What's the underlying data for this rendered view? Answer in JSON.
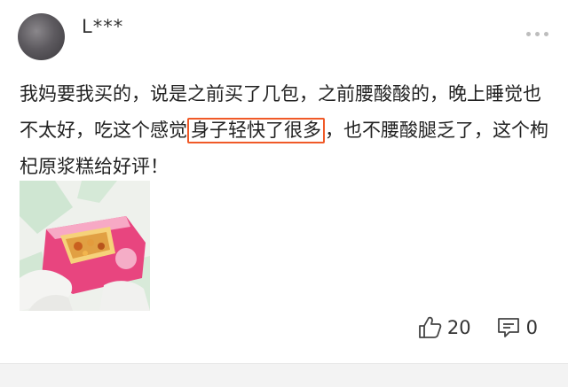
{
  "user": {
    "name": "L***"
  },
  "comment": {
    "before": "我妈要我买的，说是之前买了几包，之前腰酸酸的，晚上睡觉也不太好，吃这个感觉",
    "highlighted": "身子轻快了很多",
    "after": "，也不腰酸腿乏了，这个枸杞原浆糕给好评！"
  },
  "actions": {
    "like_count": "20",
    "comment_count": "0"
  },
  "colors": {
    "highlight_border": "#f05a28"
  },
  "icons": {
    "more": "more-dots-icon",
    "like": "thumbs-up-icon",
    "comment": "comment-bubble-icon"
  }
}
